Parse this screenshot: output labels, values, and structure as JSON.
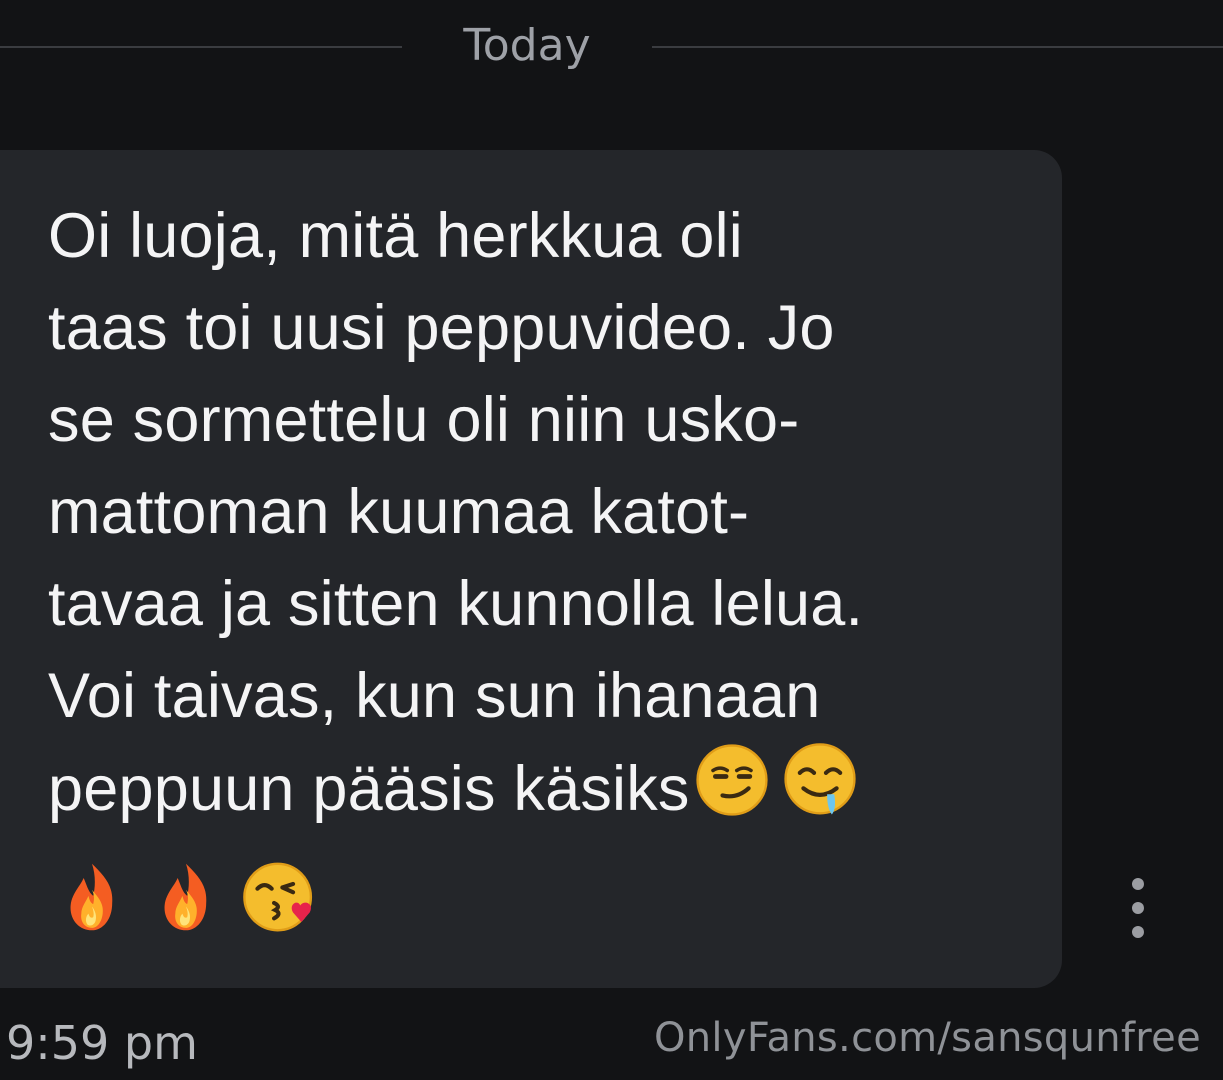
{
  "date_divider": "Today",
  "message": {
    "text": "Oi luoja, mitä herkkua oli\ntaas toi uusi peppuvideo. Jo\nse sormettelu oli niin usko-\nmattoman kuumaa katot-\ntavaa ja sitten kunnolla lelua.\nVoi taivas, kun sun ihanaan\npeppuun pääsis käsiks",
    "inline_emojis": [
      "smirk-emoji",
      "drooling-emoji"
    ],
    "trailing_emojis": [
      "fire-emoji",
      "fire-emoji",
      "kiss-heart-emoji"
    ],
    "timestamp": "9:59 pm"
  },
  "watermark": "OnlyFans.com/sansqunfree"
}
